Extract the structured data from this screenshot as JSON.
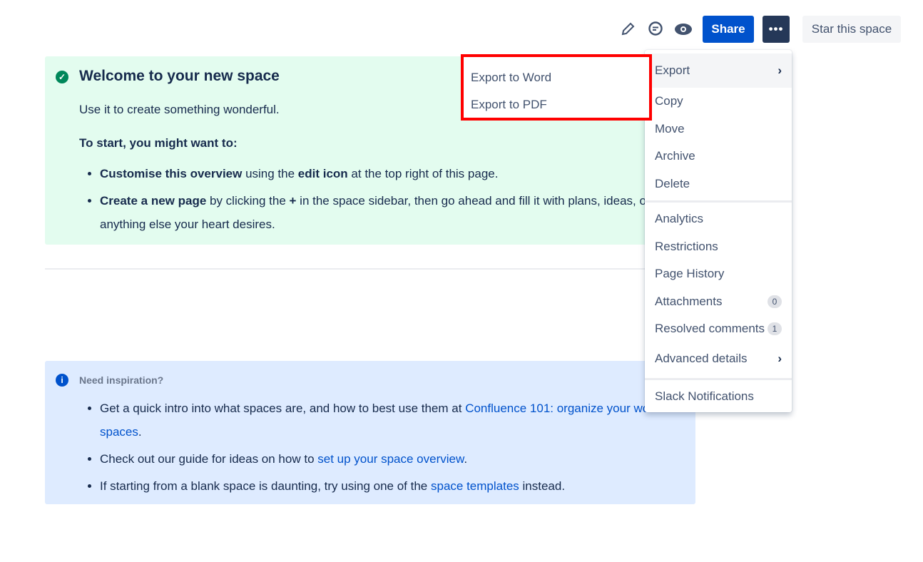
{
  "toolbar": {
    "share": "Share",
    "more": "•••",
    "star": "Star this space"
  },
  "welcome": {
    "title": "Welcome to your new space",
    "subtitle": "Use it to create something wonderful.",
    "start": "To start, you might want to:",
    "b1_bold": "Customise this overview",
    "b1_a": " using the ",
    "b1_bold2": "edit icon",
    "b1_b": " at the top right of this page.",
    "b2_bold": "Create a new page",
    "b2_a": " by clicking the ",
    "b2_plus": "+",
    "b2_b": " in the space sidebar, then go ahead and fill it with plans, ideas, or anything else your heart desires."
  },
  "inspiration": {
    "title": "Need inspiration?",
    "b1": "Get a quick intro into what spaces are, and how to best use them at ",
    "b1_link": "Confluence 101: organize your work in spaces",
    "b1_end": ".",
    "b2": "Check out our guide for ideas on how to ",
    "b2_link": "set up your space overview",
    "b2_end": ".",
    "b3": "If starting from a blank space is daunting, try using one of the ",
    "b3_link": "space templates",
    "b3_end": " instead."
  },
  "menu": {
    "export": "Export",
    "copy": "Copy",
    "move": "Move",
    "archive": "Archive",
    "delete": "Delete",
    "analytics": "Analytics",
    "restrictions": "Restrictions",
    "history": "Page History",
    "attachments": "Attachments",
    "attachments_count": "0",
    "resolved": "Resolved comments",
    "resolved_count": "1",
    "advanced": "Advanced details",
    "slack": "Slack Notifications"
  },
  "submenu": {
    "word": "Export to Word",
    "pdf": "Export to PDF"
  }
}
